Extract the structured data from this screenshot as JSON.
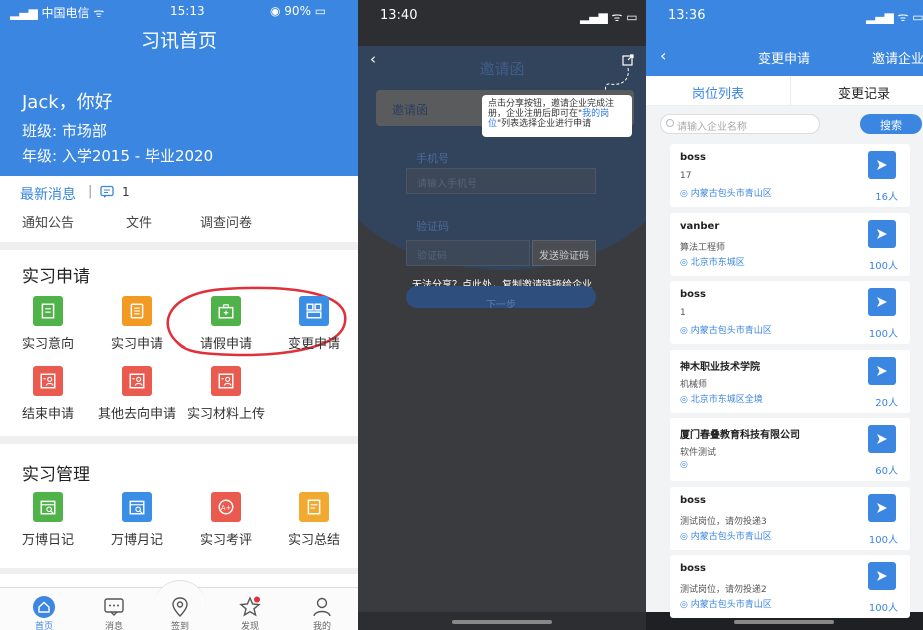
{
  "phone1": {
    "status": {
      "carrier": "中国电信",
      "time": "15:13",
      "battery": "90%"
    },
    "title": "习讯首页",
    "greeting": "Jack，你好",
    "class_line": "班级: 市场部",
    "grade_line": "年级: 入学2015 - 毕业2020",
    "news": {
      "label": "最新消息",
      "count": "1",
      "links": [
        "通知公告",
        "文件",
        "调查问卷"
      ]
    },
    "sections": [
      {
        "title": "实习申请",
        "items": [
          {
            "label": "实习意向",
            "color": "#4fb34a",
            "icon": "document-icon"
          },
          {
            "label": "实习申请",
            "color": "#f29a24",
            "icon": "scroll-icon"
          },
          {
            "label": "请假申请",
            "color": "#4fb34a",
            "icon": "briefcase-icon"
          },
          {
            "label": "变更申请",
            "color": "#3a8ee6",
            "icon": "layout-icon"
          },
          {
            "label": "结束申请",
            "color": "#ea5a4e",
            "icon": "person-card-icon"
          },
          {
            "label": "其他去向申请",
            "color": "#ea5a4e",
            "icon": "person-card-icon"
          },
          {
            "label": "实习材料上传",
            "color": "#ea5a4e",
            "icon": "person-card-icon"
          }
        ]
      },
      {
        "title": "实习管理",
        "items": [
          {
            "label": "万博日记",
            "color": "#4fb34a",
            "icon": "calendar-icon"
          },
          {
            "label": "万博月记",
            "color": "#3a8ee6",
            "icon": "calendar-icon"
          },
          {
            "label": "实习考评",
            "color": "#ea5a4e",
            "icon": "grade-icon"
          },
          {
            "label": "实习总结",
            "color": "#f2a930",
            "icon": "edit-icon"
          }
        ]
      }
    ],
    "tabs": [
      "首页",
      "消息",
      "签到",
      "发现",
      "我的"
    ]
  },
  "phone2": {
    "status": {
      "time": "13:40"
    },
    "title": "邀请函",
    "card_title": "邀请函",
    "label1": "手机号",
    "placeholder1": "请输入手机号",
    "label2": "验证码",
    "placeholder2": "验证码",
    "send_code": "发送验证码",
    "tooltip": {
      "before": "点击分享按钮，邀请企业完成注册，企业注册后即可在\"",
      "link": "我的岗位",
      "after": "\"列表选择企业进行申请"
    },
    "copy_hint": "无法分享？点此处，复制邀请链接给企业",
    "next": "下一步"
  },
  "phone3": {
    "status": {
      "time": "13:36"
    },
    "title": "变更申请",
    "right_action": "邀请企业",
    "tabs": [
      "岗位列表",
      "变更记录"
    ],
    "search_placeholder": "请输入企业名称",
    "search_button": "搜索",
    "jobs": [
      {
        "name": "boss",
        "position": "17",
        "address": "内蒙古包头市青山区",
        "count": "16人"
      },
      {
        "name": "vanber",
        "position": "算法工程师",
        "address": "北京市东城区",
        "count": "100人"
      },
      {
        "name": "boss",
        "position": "1",
        "address": "内蒙古包头市青山区",
        "count": "100人"
      },
      {
        "name": "神木职业技术学院",
        "position": "机械师",
        "address": "北京市东城区全境",
        "count": "20人"
      },
      {
        "name": "厦门春叠教育科技有限公司",
        "position": "软件测试",
        "address": "",
        "count": "60人"
      },
      {
        "name": "boss",
        "position": "测试岗位，请勿投递3",
        "address": "内蒙古包头市青山区",
        "count": "100人"
      },
      {
        "name": "boss",
        "position": "测试岗位，请勿投递2",
        "address": "内蒙古包头市青山区",
        "count": "100人"
      }
    ]
  }
}
